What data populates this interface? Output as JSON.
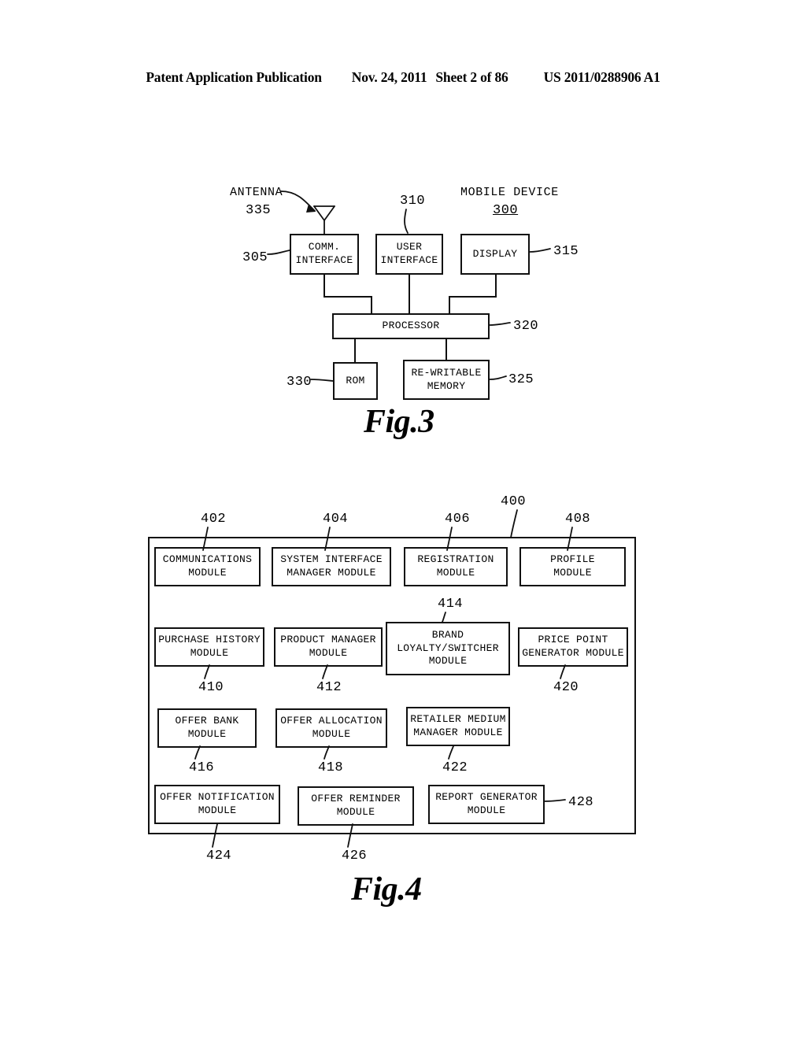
{
  "header": {
    "publication": "Patent Application Publication",
    "date": "Nov. 24, 2011",
    "sheet": "Sheet 2 of 86",
    "patent_number": "US 2011/0288906 A1"
  },
  "fig3": {
    "caption": "Fig.3",
    "labels": {
      "antenna": "ANTENNA",
      "antenna_ref": "335",
      "mobile_device": "MOBILE DEVICE",
      "mobile_device_ref": "300"
    },
    "nodes": [
      {
        "id": "comm_interface",
        "lines": [
          "COMM.",
          "INTERFACE"
        ],
        "ref": "305"
      },
      {
        "id": "user_interface",
        "lines": [
          "USER",
          "INTERFACE"
        ],
        "ref": "310"
      },
      {
        "id": "display",
        "lines": [
          "DISPLAY"
        ],
        "ref": "315"
      },
      {
        "id": "processor",
        "lines": [
          "PROCESSOR"
        ],
        "ref": "320"
      },
      {
        "id": "rom",
        "lines": [
          "ROM"
        ],
        "ref": "330"
      },
      {
        "id": "rewritable_mem",
        "lines": [
          "RE-WRITABLE",
          "MEMORY"
        ],
        "ref": "325"
      }
    ]
  },
  "fig4": {
    "caption": "Fig.4",
    "container_ref": "400",
    "nodes": [
      {
        "id": "communications_module",
        "lines": [
          "COMMUNICATIONS",
          "MODULE"
        ],
        "ref": "402"
      },
      {
        "id": "system_interface_manager",
        "lines": [
          "SYSTEM INTERFACE",
          "MANAGER MODULE"
        ],
        "ref": "404"
      },
      {
        "id": "registration_module",
        "lines": [
          "REGISTRATION",
          "MODULE"
        ],
        "ref": "406"
      },
      {
        "id": "profile_module",
        "lines": [
          "PROFILE",
          "MODULE"
        ],
        "ref": "408"
      },
      {
        "id": "purchase_history_module",
        "lines": [
          "PURCHASE HISTORY",
          "MODULE"
        ],
        "ref": "410"
      },
      {
        "id": "product_manager_module",
        "lines": [
          "PRODUCT MANAGER",
          "MODULE"
        ],
        "ref": "412"
      },
      {
        "id": "brand_loyalty_switcher",
        "lines": [
          "BRAND",
          "LOYALTY/SWITCHER",
          "MODULE"
        ],
        "ref": "414"
      },
      {
        "id": "price_point_generator_module",
        "lines": [
          "PRICE POINT",
          "GENERATOR MODULE"
        ],
        "ref": "420"
      },
      {
        "id": "offer_bank_module",
        "lines": [
          "OFFER BANK",
          "MODULE"
        ],
        "ref": "416"
      },
      {
        "id": "offer_allocation_module",
        "lines": [
          "OFFER ALLOCATION",
          "MODULE"
        ],
        "ref": "418"
      },
      {
        "id": "retailer_medium_manager",
        "lines": [
          "RETAILER MEDIUM",
          "MANAGER MODULE"
        ],
        "ref": "422"
      },
      {
        "id": "offer_notification_module",
        "lines": [
          "OFFER NOTIFICATION",
          "MODULE"
        ],
        "ref": "424"
      },
      {
        "id": "offer_reminder_module",
        "lines": [
          "OFFER REMINDER",
          "MODULE"
        ],
        "ref": "426"
      },
      {
        "id": "report_generator_module",
        "lines": [
          "REPORT GENERATOR",
          "MODULE"
        ],
        "ref": "428"
      }
    ]
  }
}
